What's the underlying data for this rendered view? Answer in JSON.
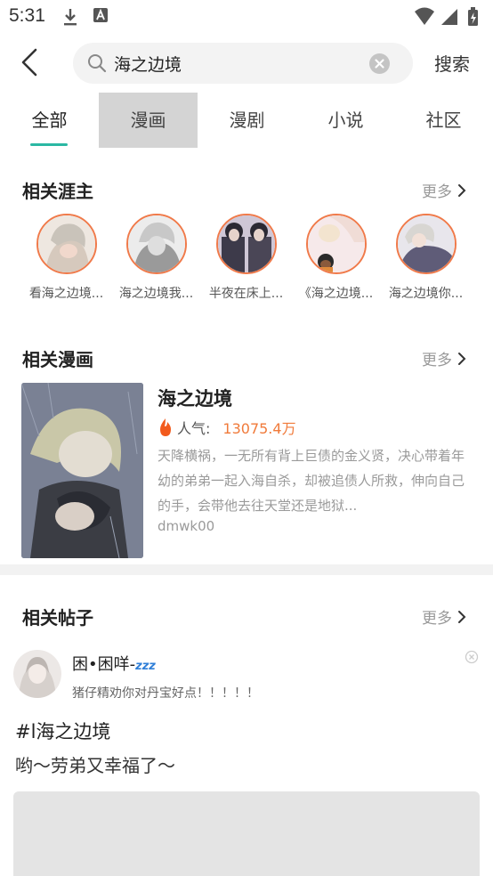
{
  "status_bar": {
    "time": "5:31"
  },
  "search": {
    "query": "海之边境",
    "button_label": "搜索"
  },
  "tabs": [
    {
      "label": "全部"
    },
    {
      "label": "漫画"
    },
    {
      "label": "漫剧"
    },
    {
      "label": "小说"
    },
    {
      "label": "社区"
    }
  ],
  "creators_section": {
    "title": "相关涯主",
    "more": "更多",
    "items": [
      {
        "name": "看海之边境..."
      },
      {
        "name": "海之边境我..."
      },
      {
        "name": "半夜在床上..."
      },
      {
        "name": "《海之边境..."
      },
      {
        "name": "海之边境你..."
      }
    ]
  },
  "comics_section": {
    "title": "相关漫画",
    "more": "更多",
    "comic": {
      "title": "海之边境",
      "popularity_label": "人气:",
      "popularity_value": "13075.4万",
      "description": "天降横祸，一无所有背上巨债的金义贤，决心带着年幼的弟弟一起入海自杀，却被追债人所救，伸向自己的手，会带他去往天堂还是地狱...",
      "author": "dmwk00"
    }
  },
  "posts_section": {
    "title": "相关帖子",
    "more": "更多",
    "post": {
      "username": "困•困咩-",
      "zzz": "zzz",
      "signature": "猪仔精劝你对丹宝好点！！！！！",
      "tag": "#l海之边境",
      "text": "哟～劳弟又幸福了～"
    }
  },
  "colors": {
    "accent": "#2bb8a3",
    "avatar_ring": "#f07a4a",
    "popularity": "#f07a3a"
  },
  "icons": {
    "back": "chevron-left-icon",
    "search": "search-icon",
    "clear": "clear-icon",
    "more": "chevron-right-icon",
    "fire": "fire-icon",
    "close": "close-circle-icon"
  }
}
